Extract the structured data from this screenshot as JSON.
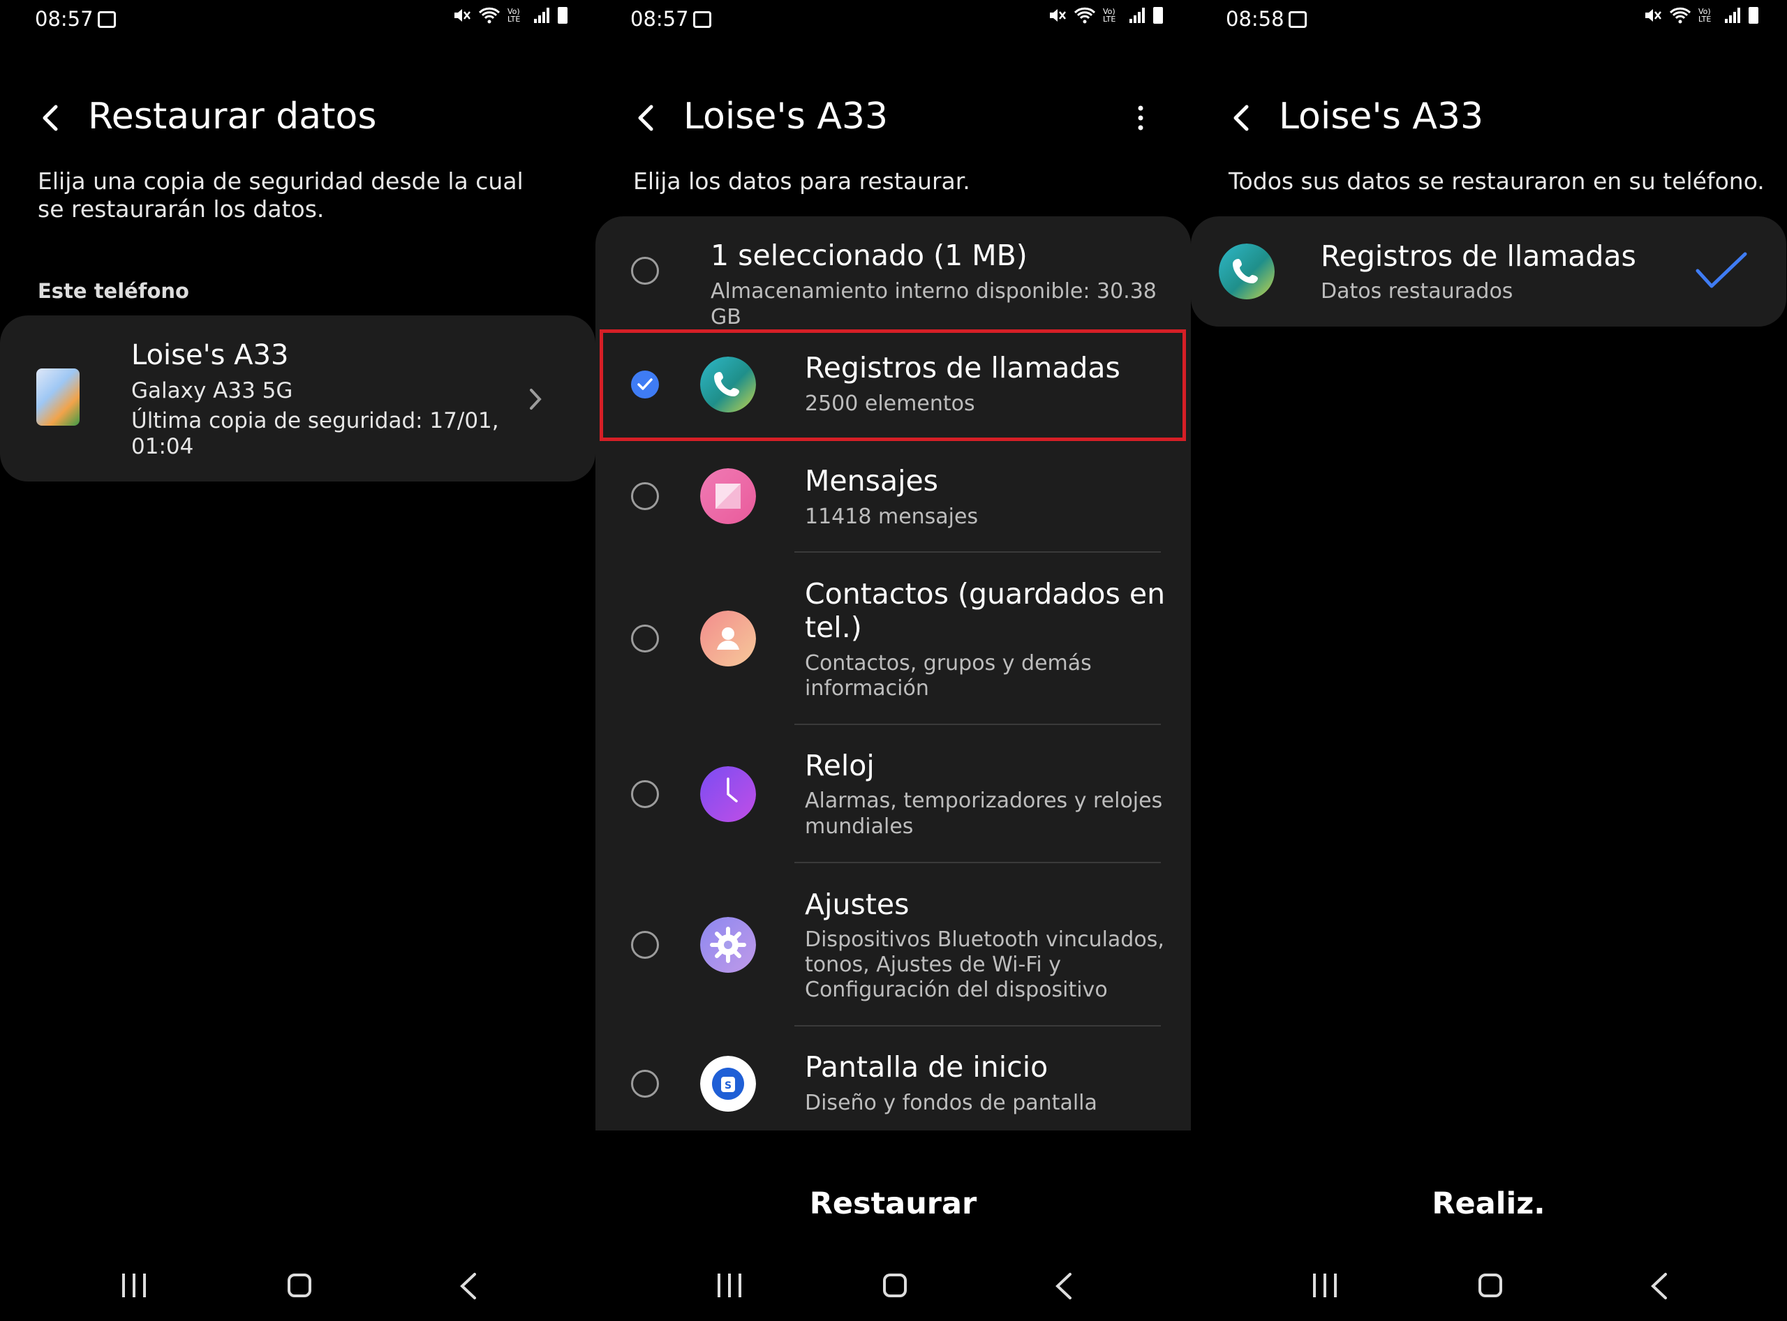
{
  "colors": {
    "background": "#000000",
    "card": "#1d1d1d",
    "accent": "#3f7cf4",
    "highlight": "#d61f26"
  },
  "panel1": {
    "status": {
      "time": "08:57"
    },
    "title": "Restaurar datos",
    "description": "Elija una copia de seguridad desde la cual se restaurarán los datos.",
    "section": "Este teléfono",
    "device": {
      "name": "Loise's A33",
      "model": "Galaxy A33 5G",
      "backup_line1": "Última copia de seguridad: 17/01,",
      "backup_line2": "01:04"
    }
  },
  "panel2": {
    "status": {
      "time": "08:57"
    },
    "title": "Loise's A33",
    "description": "Elija los datos para restaurar.",
    "summary": {
      "title": "1 seleccionado (1 MB)",
      "subtitle": "Almacenamiento interno disponible: 30.38 GB",
      "selected": false
    },
    "items": [
      {
        "title": "Registros de llamadas",
        "subtitle": "2500 elementos",
        "selected": true,
        "icon": "phone-icon"
      },
      {
        "title": "Mensajes",
        "subtitle": "11418 mensajes",
        "selected": false,
        "icon": "messages-icon"
      },
      {
        "title_line1": "Contactos (guardados en",
        "title_line2": "tel.)",
        "subtitle_line1": "Contactos, grupos y demás",
        "subtitle_line2": "información",
        "selected": false,
        "icon": "contacts-icon"
      },
      {
        "title": "Reloj",
        "subtitle_line1": "Alarmas, temporizadores y relojes",
        "subtitle_line2": "mundiales",
        "selected": false,
        "icon": "clock-icon"
      },
      {
        "title": "Ajustes",
        "subtitle_line1": "Dispositivos Bluetooth vinculados,",
        "subtitle_line2": "tonos, Ajustes de Wi-Fi y",
        "subtitle_line3": "Configuración del dispositivo",
        "selected": false,
        "icon": "settings-icon"
      },
      {
        "title": "Pantalla de inicio",
        "subtitle": "Diseño y fondos de pantalla",
        "selected": false,
        "icon": "home-screen-icon"
      }
    ],
    "button": "Restaurar"
  },
  "panel3": {
    "status": {
      "time": "08:58"
    },
    "title": "Loise's A33",
    "description": "Todos sus datos se restauraron en su teléfono.",
    "result": {
      "title": "Registros de llamadas",
      "subtitle": "Datos restaurados"
    },
    "button": "Realiz."
  },
  "status_icons": {
    "volte": "Vo) LTE"
  }
}
